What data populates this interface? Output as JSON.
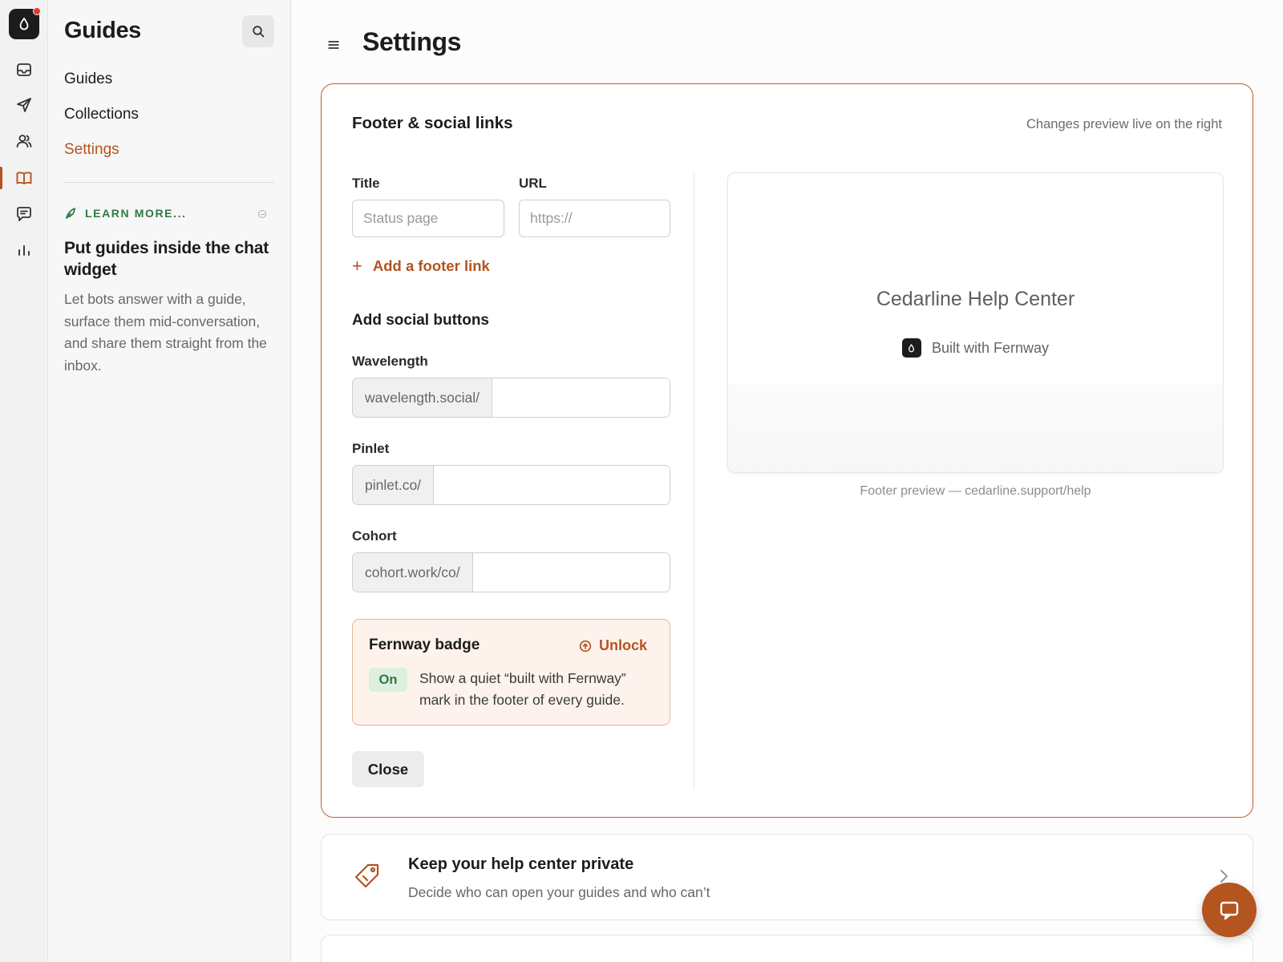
{
  "rail": {
    "items": [
      "inbox-icon",
      "send-icon",
      "people-icon",
      "book-icon",
      "chat-icon",
      "chart-icon"
    ],
    "active": "book-icon",
    "accent": "#b4541f",
    "notification_color": "#e5372e"
  },
  "sidebar": {
    "title": "Guides",
    "nav": [
      {
        "label": "Guides",
        "active": false
      },
      {
        "label": "Collections",
        "active": false
      },
      {
        "label": "Settings",
        "active": true
      }
    ],
    "learn": {
      "label": "LEARN MORE...",
      "title": "Put guides inside the chat widget",
      "body": "Let bots answer with a guide, surface them mid-conversation, and share them straight from the inbox."
    }
  },
  "page": {
    "title": "Settings"
  },
  "footer_panel": {
    "title": "Footer & social links",
    "hint": "Changes preview live on the right",
    "title_label": "Title",
    "title_placeholder": "Status page",
    "url_label": "URL",
    "url_placeholder": "https://",
    "add_link": "Add a footer link",
    "social_heading": "Add social buttons",
    "socials": [
      {
        "label": "Wavelength",
        "prefix": "wavelength.social/",
        "value": ""
      },
      {
        "label": "Pinlet",
        "prefix": "pinlet.co/",
        "value": ""
      },
      {
        "label": "Cohort",
        "prefix": "cohort.work/co/",
        "value": ""
      }
    ],
    "badge": {
      "title": "Fernway badge",
      "unlock": "Unlock",
      "status": "On",
      "description": "Show a quiet “built with Fernway” mark in the footer of every guide."
    },
    "close": "Close",
    "preview": {
      "name": "Cedarline Help Center",
      "built_with": "Built with Fernway",
      "caption": "Footer preview — cedarline.support/help"
    },
    "border_color": "#c25e26"
  },
  "private_card": {
    "title": "Keep your help center private",
    "subtitle": "Decide who can open your guides and who can’t"
  },
  "chat_fab": {
    "icon": "chat-bubble-icon"
  }
}
